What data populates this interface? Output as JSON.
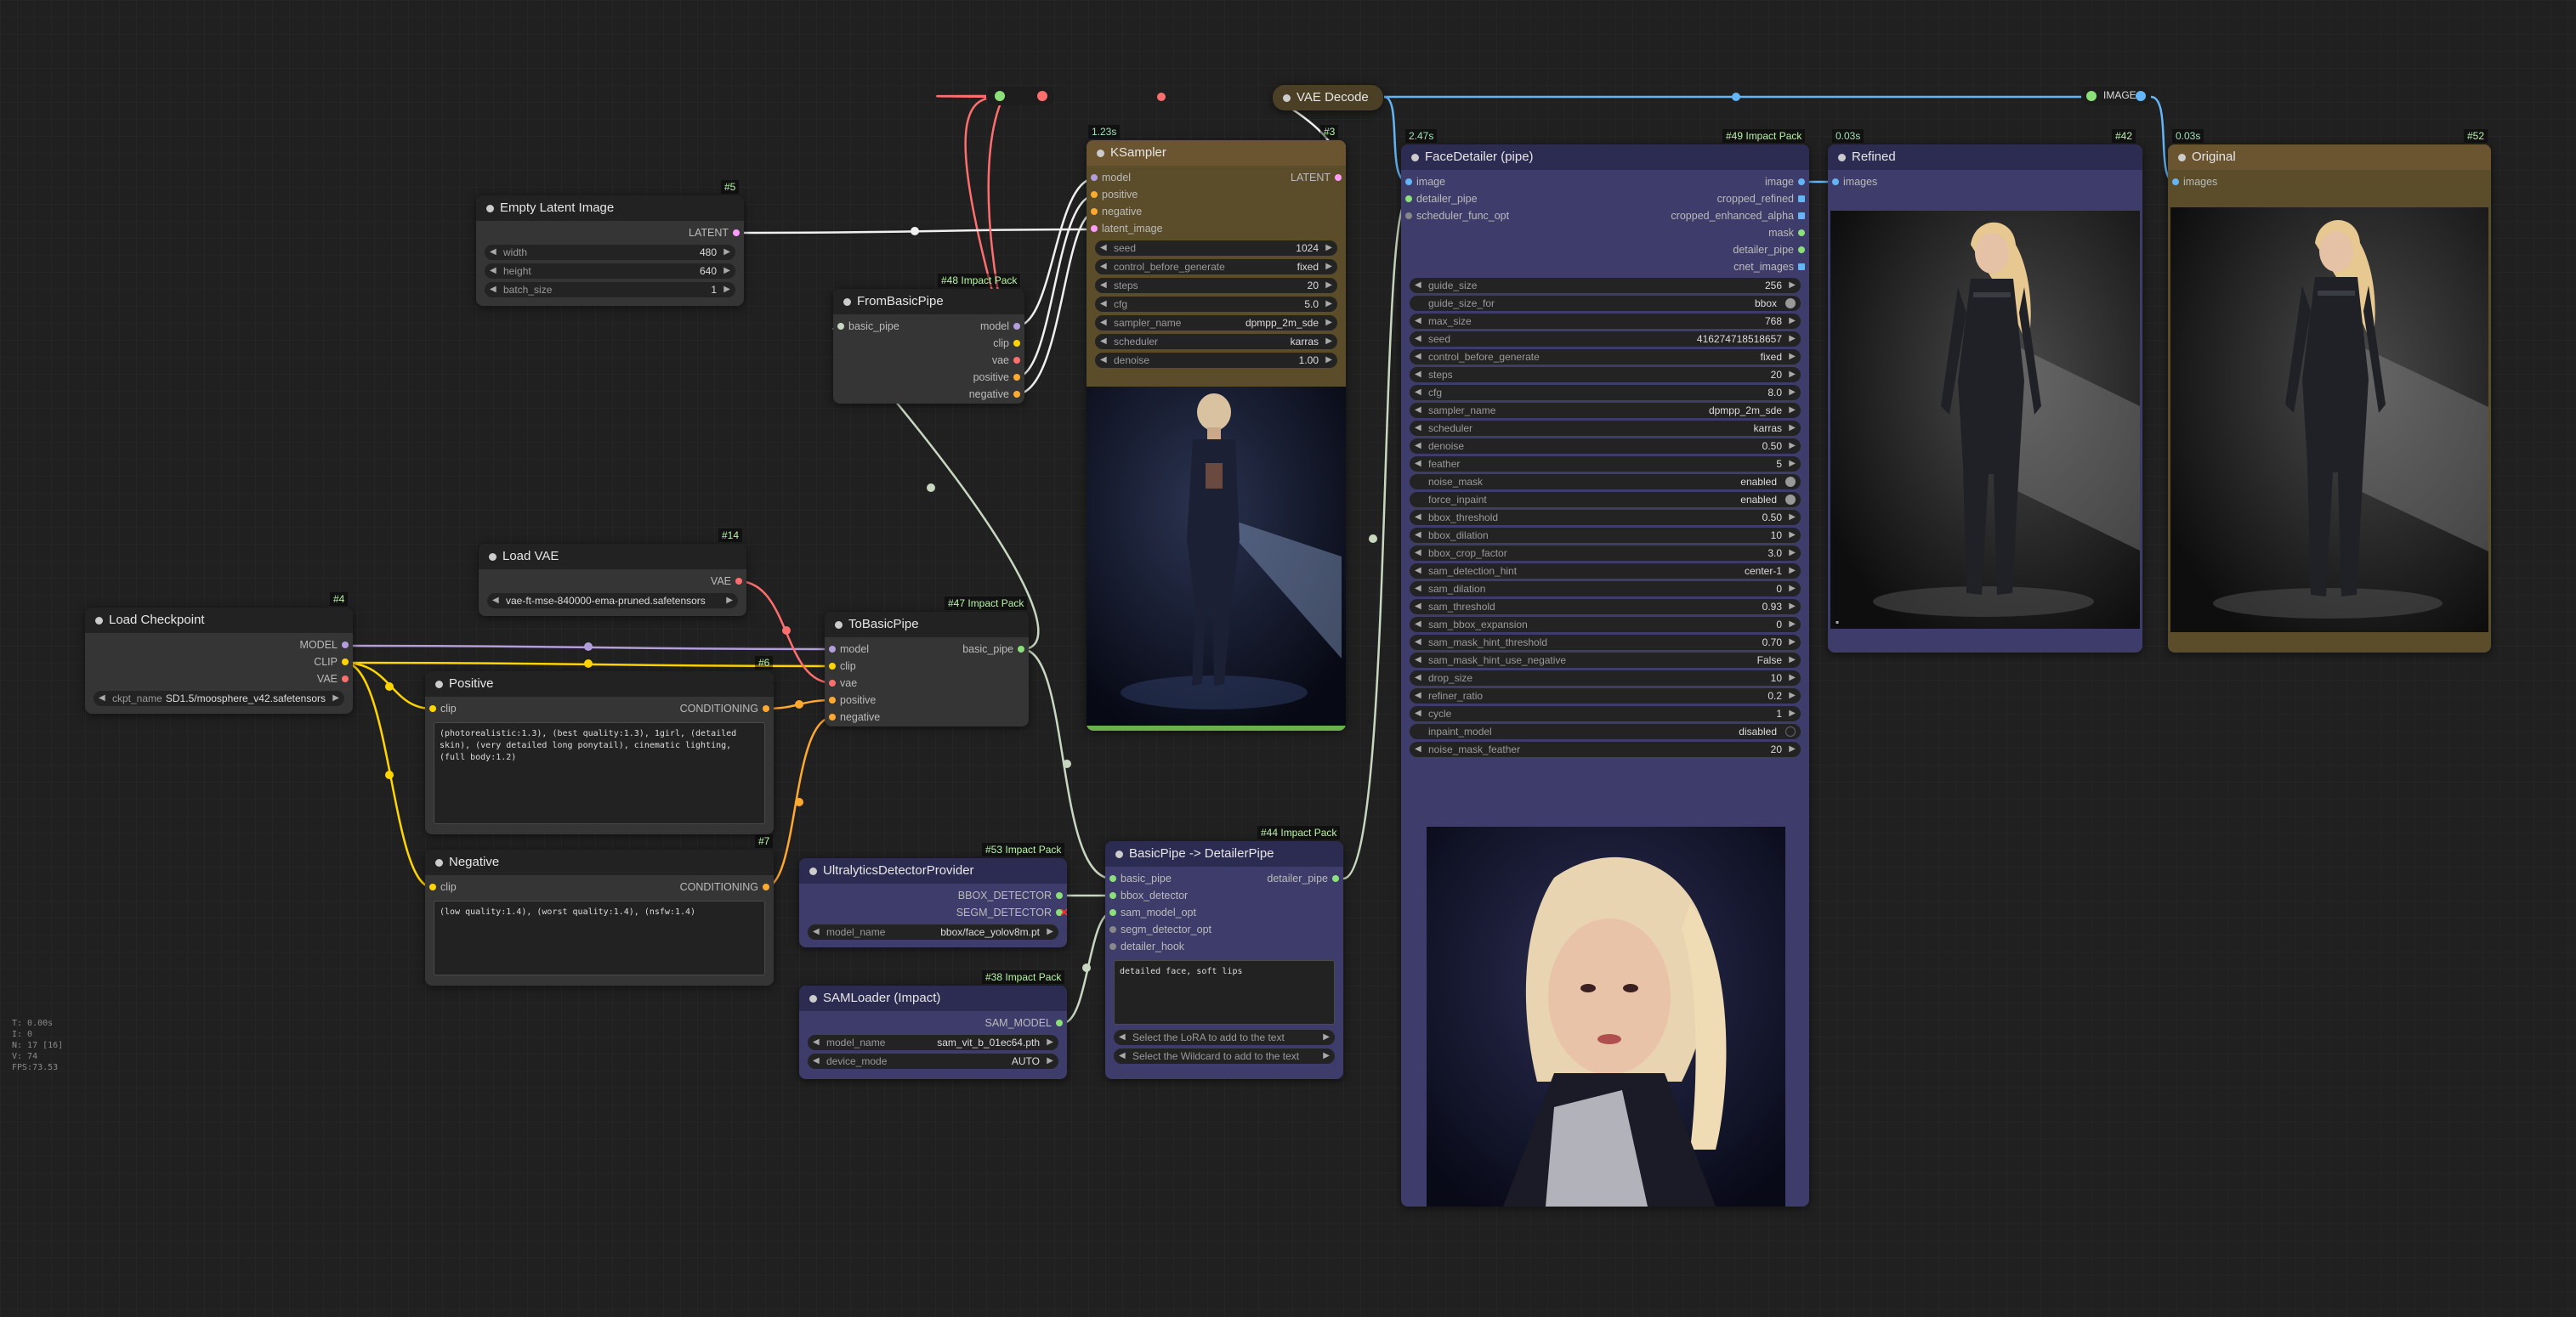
{
  "stats": [
    "T: 0.00s",
    "I: 0",
    "N: 17 [16]",
    "V: 74",
    "FPS:73.53"
  ],
  "colors": {
    "model": "#b39ddb",
    "clip": "#ffd500",
    "vae": "#ff6e6e",
    "latent": "#ff9cf9",
    "conditioning": "#ffa931",
    "image": "#64b5f6",
    "pipe": "#c8d8c0"
  },
  "nodes": {
    "load_checkpoint": {
      "id": "#4",
      "title": "Load Checkpoint",
      "outputs": [
        "MODEL",
        "CLIP",
        "VAE"
      ],
      "widget_name": "ckpt_name",
      "widget_value": "SD1.5/moosphere_v42.safetensors"
    },
    "load_vae": {
      "id": "#14",
      "title": "Load VAE",
      "outputs": [
        "VAE"
      ],
      "widget_name": "vae_name",
      "widget_value": "vae-ft-mse-840000-ema-pruned.safetensors"
    },
    "empty_latent": {
      "id": "#5",
      "title": "Empty Latent Image",
      "outputs": [
        "LATENT"
      ],
      "widgets": [
        {
          "name": "width",
          "value": "480"
        },
        {
          "name": "height",
          "value": "640"
        },
        {
          "name": "batch_size",
          "value": "1"
        }
      ]
    },
    "positive": {
      "id": "#6",
      "title": "Positive",
      "input": "clip",
      "output": "CONDITIONING",
      "text": "(photorealistic:1.3), (best quality:1.3), 1girl, (detailed skin), (very detailed long ponytail), cinematic lighting, (full body:1.2)"
    },
    "negative": {
      "id": "#7",
      "title": "Negative",
      "input": "clip",
      "output": "CONDITIONING",
      "text": "(low quality:1.4), (worst quality:1.4), (nsfw:1.4)"
    },
    "from_basic_pipe": {
      "id": "#48 Impact Pack",
      "title": "FromBasicPipe",
      "input": "basic_pipe",
      "outputs": [
        "model",
        "clip",
        "vae",
        "positive",
        "negative"
      ]
    },
    "to_basic_pipe": {
      "id": "#47 Impact Pack",
      "title": "ToBasicPipe",
      "inputs": [
        "model",
        "clip",
        "vae",
        "positive",
        "negative"
      ],
      "output": "basic_pipe"
    },
    "ksampler": {
      "id": "#3",
      "time": "1.23s",
      "title": "KSampler",
      "inputs": [
        "model",
        "positive",
        "negative",
        "latent_image"
      ],
      "output": "LATENT",
      "widgets": [
        {
          "name": "seed",
          "value": "1024"
        },
        {
          "name": "control_before_generate",
          "value": "fixed"
        },
        {
          "name": "steps",
          "value": "20"
        },
        {
          "name": "cfg",
          "value": "5.0"
        },
        {
          "name": "sampler_name",
          "value": "dpmpp_2m_sde"
        },
        {
          "name": "scheduler",
          "value": "karras"
        },
        {
          "name": "denoise",
          "value": "1.00"
        }
      ]
    },
    "vae_decode": {
      "title": "VAE Decode"
    },
    "ultralytics": {
      "id": "#53 Impact Pack",
      "title": "UltralyticsDetectorProvider",
      "outputs": [
        "BBOX_DETECTOR",
        "SEGM_DETECTOR"
      ],
      "widget_name": "model_name",
      "widget_value": "bbox/face_yolov8m.pt"
    },
    "samloader": {
      "id": "#38 Impact Pack",
      "title": "SAMLoader (Impact)",
      "output": "SAM_MODEL",
      "widgets": [
        {
          "name": "model_name",
          "value": "sam_vit_b_01ec64.pth"
        },
        {
          "name": "device_mode",
          "value": "AUTO"
        }
      ]
    },
    "basicpipe_detailer": {
      "id": "#44 Impact Pack",
      "title": "BasicPipe -> DetailerPipe",
      "inputs": [
        "basic_pipe",
        "bbox_detector",
        "sam_model_opt",
        "segm_detector_opt",
        "detailer_hook"
      ],
      "output": "detailer_pipe",
      "text": "detailed face, soft lips",
      "combo_a": "Select the LoRA to add to the text",
      "combo_b": "Select the Wildcard to add to the text"
    },
    "face_detailer": {
      "id": "#49 Impact Pack",
      "time": "2.47s",
      "title": "FaceDetailer (pipe)",
      "inputs": [
        "image",
        "detailer_pipe",
        "scheduler_func_opt"
      ],
      "outputs": [
        "image",
        "cropped_refined",
        "cropped_enhanced_alpha",
        "mask",
        "detailer_pipe",
        "cnet_images"
      ],
      "widgets": [
        {
          "name": "guide_size",
          "value": "256",
          "kind": "num"
        },
        {
          "name": "guide_size_for",
          "value": "bbox",
          "kind": "toggle",
          "on": true
        },
        {
          "name": "max_size",
          "value": "768",
          "kind": "num"
        },
        {
          "name": "seed",
          "value": "416274718518657",
          "kind": "num"
        },
        {
          "name": "control_before_generate",
          "value": "fixed",
          "kind": "num"
        },
        {
          "name": "steps",
          "value": "20",
          "kind": "num"
        },
        {
          "name": "cfg",
          "value": "8.0",
          "kind": "num"
        },
        {
          "name": "sampler_name",
          "value": "dpmpp_2m_sde",
          "kind": "num"
        },
        {
          "name": "scheduler",
          "value": "karras",
          "kind": "num"
        },
        {
          "name": "denoise",
          "value": "0.50",
          "kind": "num"
        },
        {
          "name": "feather",
          "value": "5",
          "kind": "num"
        },
        {
          "name": "noise_mask",
          "value": "enabled",
          "kind": "toggle",
          "on": true
        },
        {
          "name": "force_inpaint",
          "value": "enabled",
          "kind": "toggle",
          "on": true
        },
        {
          "name": "bbox_threshold",
          "value": "0.50",
          "kind": "num"
        },
        {
          "name": "bbox_dilation",
          "value": "10",
          "kind": "num"
        },
        {
          "name": "bbox_crop_factor",
          "value": "3.0",
          "kind": "num"
        },
        {
          "name": "sam_detection_hint",
          "value": "center-1",
          "kind": "num"
        },
        {
          "name": "sam_dilation",
          "value": "0",
          "kind": "num"
        },
        {
          "name": "sam_threshold",
          "value": "0.93",
          "kind": "num"
        },
        {
          "name": "sam_bbox_expansion",
          "value": "0",
          "kind": "num"
        },
        {
          "name": "sam_mask_hint_threshold",
          "value": "0.70",
          "kind": "num"
        },
        {
          "name": "sam_mask_hint_use_negative",
          "value": "False",
          "kind": "num"
        },
        {
          "name": "drop_size",
          "value": "10",
          "kind": "num"
        },
        {
          "name": "refiner_ratio",
          "value": "0.2",
          "kind": "num"
        },
        {
          "name": "cycle",
          "value": "1",
          "kind": "num"
        },
        {
          "name": "inpaint_model",
          "value": "disabled",
          "kind": "toggle",
          "on": false
        },
        {
          "name": "noise_mask_feather",
          "value": "20",
          "kind": "num"
        }
      ]
    },
    "refined": {
      "id": "#42",
      "time": "0.03s",
      "title": "Refined",
      "input": "images"
    },
    "original": {
      "id": "#52",
      "time": "0.03s",
      "title": "Original",
      "input": "images"
    },
    "image_reroute": {
      "label": "IMAGE"
    }
  }
}
